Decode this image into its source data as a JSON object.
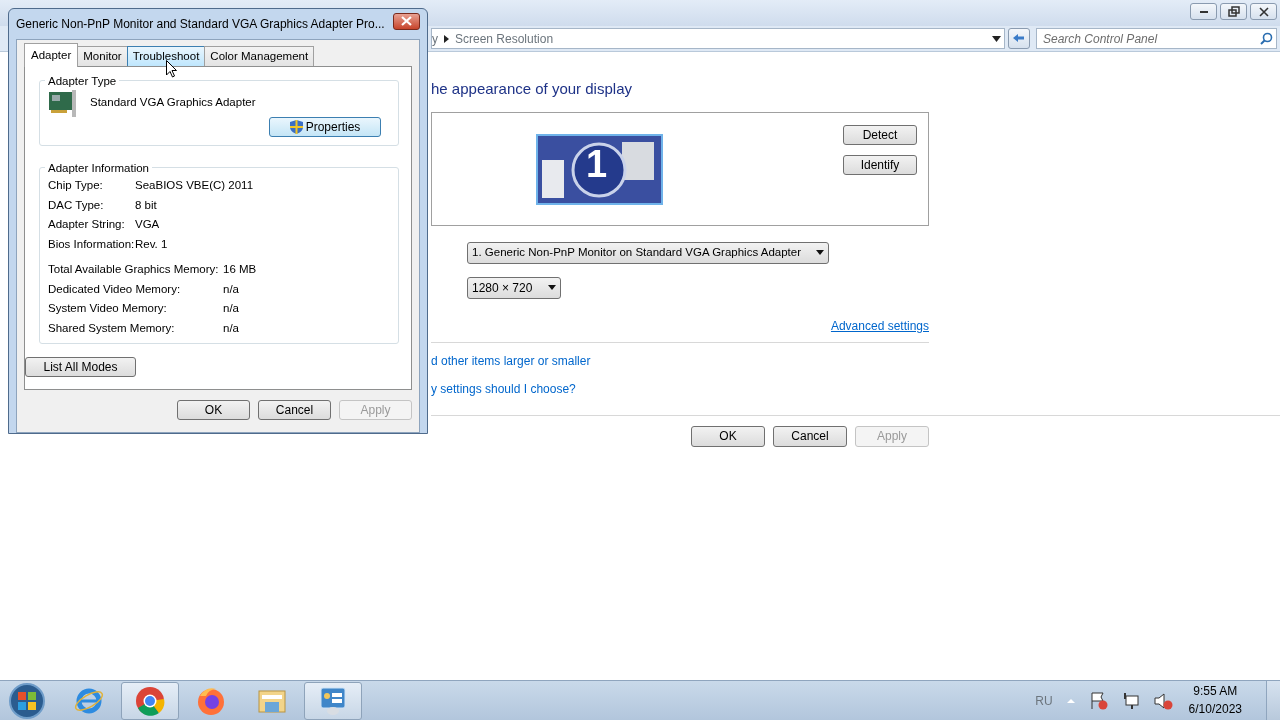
{
  "main_window": {
    "breadcrumb": [
      "y",
      "Screen Resolution"
    ],
    "search": {
      "placeholder": "Search Control Panel"
    },
    "heading": "he appearance of your display",
    "monitor_number": "1",
    "side_buttons": [
      "Detect",
      "Identify"
    ],
    "display_select": "1. Generic Non-PnP Monitor on Standard VGA Graphics Adapter",
    "resolution_select": "1280 × 720",
    "advanced_link": "Advanced settings",
    "links": [
      "d other items larger or smaller",
      "y settings should I choose?"
    ],
    "buttons": [
      {
        "label": "OK",
        "disabled": false
      },
      {
        "label": "Cancel",
        "disabled": false
      },
      {
        "label": "Apply",
        "disabled": true
      }
    ]
  },
  "dialog": {
    "title": "Generic Non-PnP Monitor and Standard VGA Graphics Adapter Pro...",
    "tabs": [
      {
        "label": "Adapter",
        "selected": true,
        "hovered": false
      },
      {
        "label": "Monitor",
        "selected": false,
        "hovered": false
      },
      {
        "label": "Troubleshoot",
        "selected": false,
        "hovered": true
      },
      {
        "label": "Color Management",
        "selected": false,
        "hovered": false
      }
    ],
    "adapter_type": {
      "heading": "Adapter Type",
      "name": "Standard VGA Graphics Adapter",
      "properties_button": "Properties"
    },
    "adapter_info": {
      "heading": "Adapter Information",
      "rows": [
        {
          "label": "Chip Type:",
          "value": "SeaBIOS VBE(C) 2011"
        },
        {
          "label": "DAC Type:",
          "value": "8 bit"
        },
        {
          "label": "Adapter String:",
          "value": "VGA"
        },
        {
          "label": "Bios Information:",
          "value": "Rev. 1"
        }
      ],
      "memory_rows": [
        {
          "label": "Total Available Graphics Memory:",
          "value": "16 MB"
        },
        {
          "label": "Dedicated Video Memory:",
          "value": "n/a"
        },
        {
          "label": "System Video Memory:",
          "value": "n/a"
        },
        {
          "label": "Shared System Memory:",
          "value": "n/a"
        }
      ]
    },
    "list_modes_button": "List All Modes",
    "buttons": [
      {
        "label": "OK",
        "disabled": false
      },
      {
        "label": "Cancel",
        "disabled": false
      },
      {
        "label": "Apply",
        "disabled": true
      }
    ]
  },
  "taskbar": {
    "apps": [
      {
        "kind": "ie",
        "active": false
      },
      {
        "kind": "chrome",
        "active": true
      },
      {
        "kind": "firefox",
        "active": false
      },
      {
        "kind": "explorer",
        "active": false
      },
      {
        "kind": "control-panel",
        "active": true
      }
    ],
    "language": "RU",
    "time": "9:55 AM",
    "date": "6/10/2023"
  }
}
